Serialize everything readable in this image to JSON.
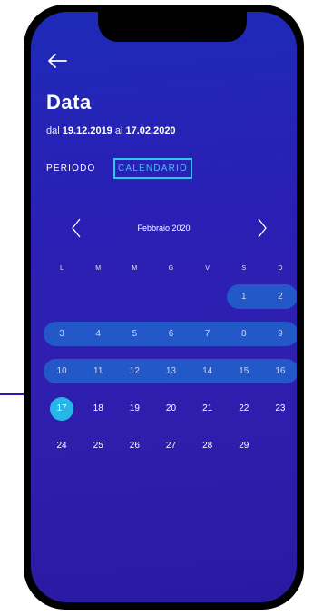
{
  "header": {
    "title": "Data",
    "range_prefix": "dal",
    "range_start": "19.12.2019",
    "range_mid": "al",
    "range_end": "17.02.2020"
  },
  "tabs": [
    {
      "label": "PERIODO",
      "active": false
    },
    {
      "label": "CALENDARIO",
      "active": true
    }
  ],
  "calendar": {
    "month_label": "Febbraio 2020",
    "weekdays": [
      "L",
      "M",
      "M",
      "G",
      "V",
      "S",
      "D"
    ],
    "weeks": [
      [
        "",
        "",
        "",
        "",
        "",
        "1",
        "2"
      ],
      [
        "3",
        "4",
        "5",
        "6",
        "7",
        "8",
        "9"
      ],
      [
        "10",
        "11",
        "12",
        "13",
        "14",
        "15",
        "16"
      ],
      [
        "17",
        "18",
        "19",
        "20",
        "21",
        "22",
        "23"
      ],
      [
        "24",
        "25",
        "26",
        "27",
        "28",
        "29",
        ""
      ]
    ],
    "selected_day": "17",
    "highlight_color": "#2258c8",
    "selected_color": "#26b7e8"
  },
  "colors": {
    "background_gradient": [
      "#1e2ab9",
      "#2a1aa2"
    ],
    "accent": "#38c9f0"
  },
  "icons": {
    "back": "arrow-left-icon",
    "prev": "chevron-left-icon",
    "next": "chevron-right-icon"
  }
}
